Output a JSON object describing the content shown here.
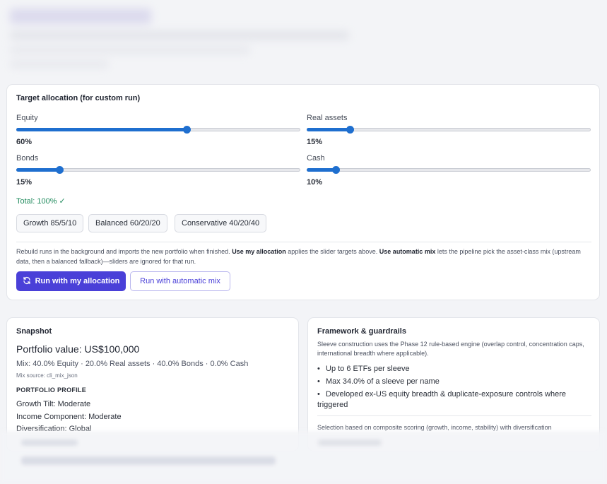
{
  "allocation": {
    "title": "Target allocation (for custom run)",
    "sliders": [
      {
        "label": "Equity",
        "value": 60,
        "display": "60%"
      },
      {
        "label": "Real assets",
        "value": 15,
        "display": "15%"
      },
      {
        "label": "Bonds",
        "value": 15,
        "display": "15%"
      },
      {
        "label": "Cash",
        "value": 10,
        "display": "10%"
      }
    ],
    "total": "Total: 100% ✓",
    "presets": [
      "Growth 85/5/10",
      "Balanced 60/20/20",
      "Conservative 40/20/40"
    ],
    "note_part1": "Rebuild runs in the background and imports the new portfolio when finished. ",
    "note_bold1": "Use my allocation",
    "note_part2": " applies the slider targets above. ",
    "note_bold2": "Use automatic mix",
    "note_part3": " lets the pipeline pick the asset-class mix (upstream data, then a balanced fallback)—sliders are ignored for that run.",
    "run_primary": "Run with my allocation",
    "run_secondary": "Run with automatic mix"
  },
  "snapshot": {
    "title": "Snapshot",
    "portfolio_value": "Portfolio value: US$100,000",
    "mix": "Mix: 40.0% Equity · 20.0% Real assets · 40.0% Bonds · 0.0% Cash",
    "mix_source": "Mix source: cli_mix_json",
    "profile_heading": "PORTFOLIO PROFILE",
    "profile": [
      "Growth Tilt: Moderate",
      "Income Component: Moderate",
      "Diversification: Global"
    ]
  },
  "framework": {
    "title": "Framework & guardrails",
    "description": "Sleeve construction uses the Phase 12 rule-based engine (overlap control, concentration caps, international breadth where applicable).",
    "items": [
      "Up to 6 ETFs per sleeve",
      "Max 34.0% of a sleeve per name",
      "Developed ex-US equity breadth & duplicate-exposure controls where triggered"
    ],
    "footer": "Selection based on composite scoring (growth, income, stability) with diversification"
  },
  "colors": {
    "accent": "#4a40d8",
    "slider": "#1f6fcf",
    "success": "#1f8a5c"
  },
  "icons": {
    "run_primary": "refresh-icon"
  }
}
